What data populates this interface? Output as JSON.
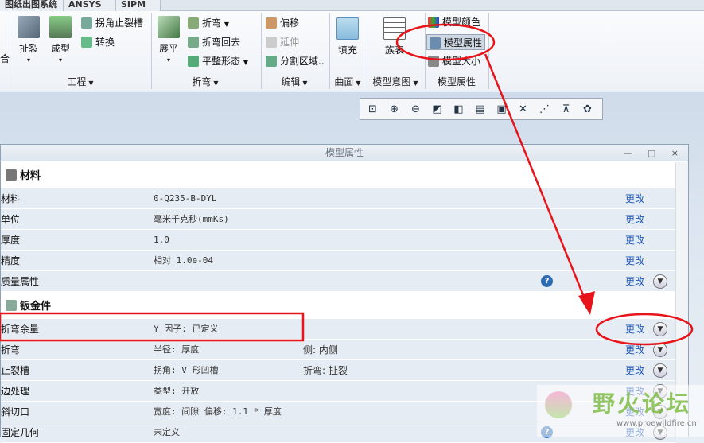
{
  "tabs": [
    "图纸出图系统",
    "ANSYS",
    "SIPM"
  ],
  "ribbon": {
    "cut_left_label": "合",
    "groups": {
      "engineering": "工程",
      "bend": "折弯",
      "edit": "编辑",
      "surface": "曲面",
      "model_intent": "模型意图",
      "model_props": "模型属性"
    },
    "tear": "扯裂",
    "form": "成型",
    "corner_relief": "拐角止裂槽",
    "convert": "转换",
    "flatten": "展平",
    "bend_btn": "折弯",
    "bend_back": "折弯回去",
    "flat_state": "平整形态",
    "offset": "偏移",
    "extend": "延伸",
    "split_region": "分割区域",
    "fill": "填充",
    "family_table": "族表",
    "model_color": "模型颜色",
    "model_props": "模型属性",
    "model_size": "模型大小"
  },
  "view_toolbar": {
    "icons": [
      "zoom-fit-icon",
      "zoom-in-icon",
      "zoom-out-icon",
      "repaint-icon",
      "display-style-icon",
      "saved-views-icon",
      "view-manager-icon",
      "datum-display-icon",
      "points-display-icon",
      "csys-display-icon",
      "annotation-display-icon"
    ]
  },
  "dialog": {
    "title": "模型属性",
    "controls": "— □ ×",
    "sections": [
      {
        "name": "材料",
        "rows": [
          {
            "label": "材料",
            "value": "0-Q235-B-DYL",
            "value2": "",
            "action": "更改",
            "info": false,
            "expand": false
          },
          {
            "label": "单位",
            "value": "毫米千克秒(mmKs)",
            "value2": "",
            "action": "更改",
            "info": false,
            "expand": false
          },
          {
            "label": "厚度",
            "value": "1.0",
            "value2": "",
            "action": "更改",
            "info": false,
            "expand": false
          },
          {
            "label": "精度",
            "value": "相对 1.0e-04",
            "value2": "",
            "action": "更改",
            "info": false,
            "expand": false
          },
          {
            "label": "质量属性",
            "value": "",
            "value2": "",
            "action": "更改",
            "info": true,
            "expand": true
          }
        ]
      },
      {
        "name": "钣金件",
        "rows": [
          {
            "label": "折弯余量",
            "value": "Y 因子: 已定义",
            "value2": "",
            "action": "更改",
            "info": false,
            "expand": true
          },
          {
            "label": "折弯",
            "value": "半径: 厚度",
            "value2": "侧: 内侧",
            "action": "更改",
            "info": false,
            "expand": true
          },
          {
            "label": "止裂槽",
            "value": "拐角: V 形凹槽",
            "value2": "折弯: 扯裂",
            "action": "更改",
            "info": false,
            "expand": true
          },
          {
            "label": "边处理",
            "value": "类型: 开放",
            "value2": "",
            "action": "更改",
            "info": false,
            "expand": true
          },
          {
            "label": "斜切口",
            "value": "宽度: 间隙 偏移: 1.1 * 厚度",
            "value2": "",
            "action": "更改",
            "info": false,
            "expand": true
          },
          {
            "label": "固定几何",
            "value": "未定义",
            "value2": "",
            "action": "更改",
            "info": true,
            "expand": true
          }
        ]
      }
    ]
  },
  "watermark": {
    "title": "野火论坛",
    "url": "www.proewildfire.cn"
  },
  "colors": {
    "annotation_red": "#e8141a",
    "link_blue": "#1b56b8",
    "row_bg": "#e6ecf3"
  }
}
